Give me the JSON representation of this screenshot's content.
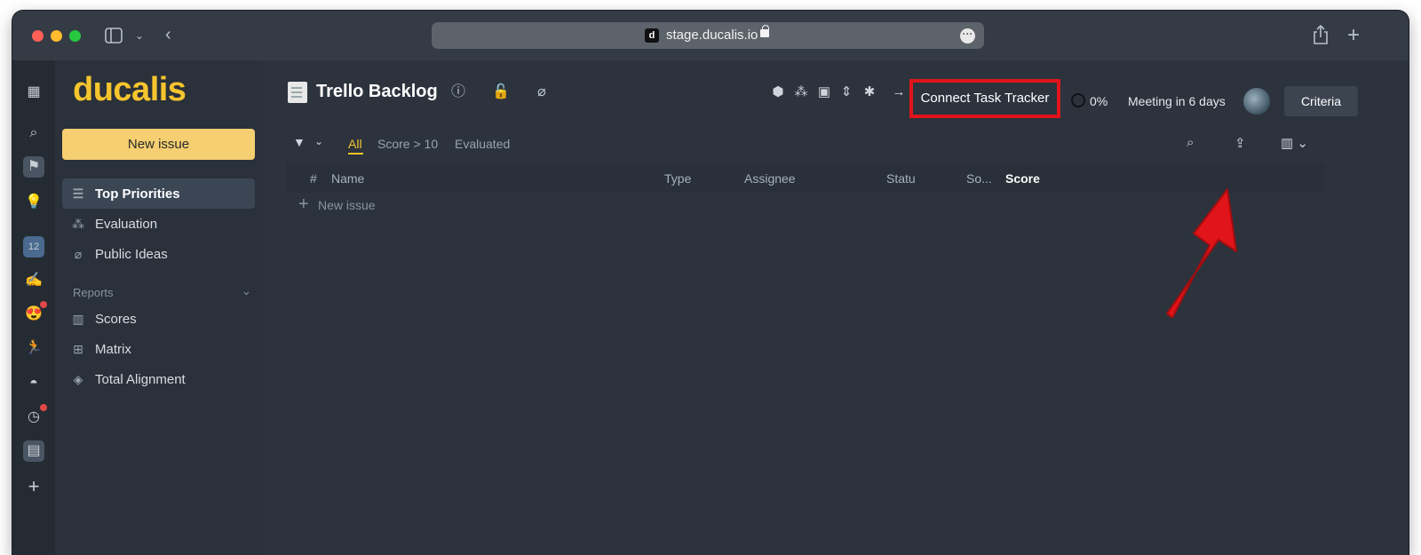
{
  "browser": {
    "url": "stage.ducalis.io",
    "favicon_letter": "d"
  },
  "sidebar": {
    "logo": "ducalis",
    "new_issue": "New issue",
    "items": [
      {
        "label": "Top Priorities",
        "icon": "list-icon",
        "active": true
      },
      {
        "label": "Evaluation",
        "icon": "evaluation-icon",
        "active": false
      },
      {
        "label": "Public Ideas",
        "icon": "public-ideas-icon",
        "active": false
      }
    ],
    "reports_label": "Reports",
    "reports": [
      {
        "label": "Scores",
        "icon": "columns-icon"
      },
      {
        "label": "Matrix",
        "icon": "grid-icon"
      },
      {
        "label": "Total Alignment",
        "icon": "layers-icon"
      }
    ]
  },
  "header": {
    "title": "Trello Backlog",
    "connect_label": "Connect Task Tracker",
    "progress": "0%",
    "meeting": "Meeting in 6 days",
    "criteria_label": "Criteria"
  },
  "filters": {
    "tabs": [
      "All",
      "Score > 10",
      "Evaluated"
    ],
    "active": "All"
  },
  "table": {
    "columns": [
      "#",
      "Name",
      "Type",
      "Assignee",
      "Statu",
      "So...",
      "Score"
    ],
    "new_row_label": "New issue"
  },
  "colors": {
    "accent": "#f6c42e",
    "highlight": "#e0141a"
  }
}
